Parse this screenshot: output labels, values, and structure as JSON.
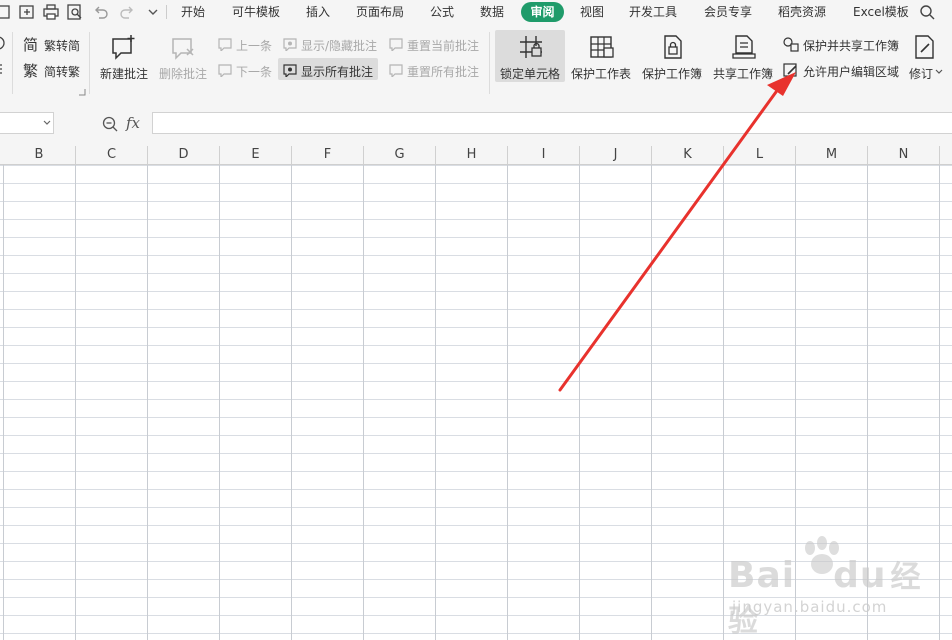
{
  "menu": {
    "tabs": [
      "开始",
      "可牛模板",
      "插入",
      "页面布局",
      "公式",
      "数据",
      "审阅",
      "视图",
      "开发工具",
      "会员专享",
      "稻壳资源",
      "Excel模板"
    ],
    "active": "审阅"
  },
  "ribbon": {
    "trad_to_simp": "繁转简",
    "simp_to_trad": "简转繁",
    "new_comment": "新建批注",
    "delete_comment": "删除批注",
    "prev": "上一条",
    "next": "下一条",
    "show_hide_comment": "显示/隐藏批注",
    "show_all_comments": "显示所有批注",
    "reset_current_comment": "重置当前批注",
    "reset_all_comments": "重置所有批注",
    "lock_cells": "锁定单元格",
    "protect_sheet": "保护工作表",
    "protect_workbook": "保护工作簿",
    "share_workbook": "共享工作簿",
    "protect_and_share": "保护并共享工作簿",
    "allow_edit_ranges": "允许用户编辑区域",
    "track_changes": "修订"
  },
  "formula_bar": {
    "fx": "fx",
    "name_value": "",
    "formula_value": ""
  },
  "columns": [
    "B",
    "C",
    "D",
    "E",
    "F",
    "G",
    "H",
    "I",
    "J",
    "K",
    "L",
    "M",
    "N"
  ],
  "watermark": {
    "brand": "Bai",
    "brand2": "du",
    "brand_cn": "经验",
    "url": "jingyan.baidu.com"
  },
  "colors": {
    "accent": "#1f9b6a",
    "arrow": "#e8322d",
    "grid": "#d9dde3"
  }
}
